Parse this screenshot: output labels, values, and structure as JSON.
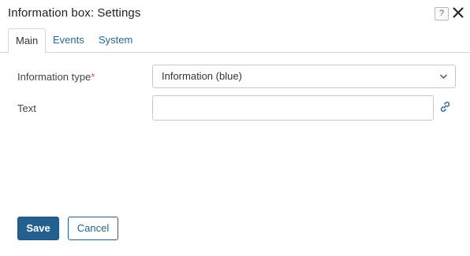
{
  "window": {
    "title": "Information box: Settings",
    "help_label": "?"
  },
  "tabs": [
    {
      "label": "Main",
      "active": true
    },
    {
      "label": "Events",
      "active": false
    },
    {
      "label": "System",
      "active": false
    }
  ],
  "form": {
    "info_type": {
      "label": "Information type",
      "required_mark": "*",
      "value": "Information (blue)"
    },
    "text": {
      "label": "Text",
      "value": ""
    }
  },
  "buttons": {
    "save": "Save",
    "cancel": "Cancel"
  },
  "colors": {
    "primary": "#24608f",
    "link": "#2a6496",
    "required": "#d9534f",
    "border": "#c9c9c9"
  },
  "icons": {
    "help": "help-icon",
    "close": "close-icon",
    "dropdown": "chevron-down-icon",
    "link": "link-icon"
  }
}
